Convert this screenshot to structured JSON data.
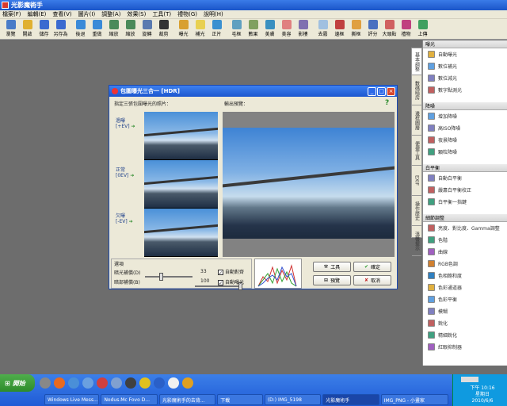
{
  "app": {
    "title": "光影魔術手"
  },
  "menu": [
    "檔案(F)",
    "編輯(E)",
    "查看(V)",
    "圖片(I)",
    "調整(A)",
    "效果(S)",
    "工具(T)",
    "禮物(G)",
    "說明(H)"
  ],
  "toolbar": [
    {
      "label": "瀏覽",
      "color": "#4a7cc8"
    },
    {
      "label": "開啟",
      "color": "#e0b030"
    },
    {
      "label": "儲存",
      "color": "#3a6ad0"
    },
    {
      "label": "另存為",
      "color": "#3a6ad0"
    },
    {
      "label": "後退",
      "color": "#3a8ad8"
    },
    {
      "label": "重做",
      "color": "#3a8ad8"
    },
    {
      "label": "縮放",
      "color": "#4a8a5a"
    },
    {
      "label": "縮放",
      "color": "#4a8a5a"
    },
    {
      "label": "旋轉",
      "color": "#5a7ab0"
    },
    {
      "label": "裁剪",
      "color": "#333"
    },
    {
      "label": "曝光",
      "color": "#d8a030"
    },
    {
      "label": "補光",
      "color": "#e8d050"
    },
    {
      "label": "正片",
      "color": "#3a90d0"
    },
    {
      "label": "毛框",
      "color": "#60a0c0"
    },
    {
      "label": "數果",
      "color": "#80a060"
    },
    {
      "label": "美膚",
      "color": "#3a90c0"
    },
    {
      "label": "美容",
      "color": "#e08080"
    },
    {
      "label": "影樓",
      "color": "#8070b0"
    },
    {
      "label": "去霧",
      "color": "#a0c0e0"
    },
    {
      "label": "邊框",
      "color": "#c04040"
    },
    {
      "label": "撕框",
      "color": "#e0a040"
    },
    {
      "label": "評分",
      "color": "#4a70c0"
    },
    {
      "label": "大頭貼",
      "color": "#d06060"
    },
    {
      "label": "禮物",
      "color": "#c04080"
    },
    {
      "label": "上傳",
      "color": "#40a060"
    }
  ],
  "right_tabs": [
    "基本調整",
    "數碼暗房",
    "邊框圖層",
    "便捷工具",
    "EXIF",
    "操作歷史",
    "溫馨提示"
  ],
  "right_panel": {
    "sections": [
      {
        "title": "曝光",
        "items": [
          "自動曝光",
          "數位補光",
          "數位減光",
          "數字點測光"
        ]
      },
      {
        "title": "降噪",
        "items": [
          "增加降噪",
          "高ISO降噪",
          "夜景降噪",
          "顆粒降噪"
        ]
      },
      {
        "title": "白平衡",
        "items": [
          "自動白平衡",
          "嚴肅白平衡校正",
          "白平衡一指鍵"
        ]
      },
      {
        "title": "細節調整",
        "items": [
          "亮度、對比度、Gamma調整",
          "色階",
          "曲線",
          "RGB色調",
          "色相飽和度",
          "色彩通道器",
          "色彩平衡",
          "模糊",
          "銳化",
          "精細銳化",
          "紅眼抑制器"
        ]
      }
    ]
  },
  "dialog": {
    "title": "包圍曝光三合一 [HDR]",
    "select_label": "指定三張包圍曝光的照片：",
    "output_label": "輸出預覽：",
    "help": "?",
    "exposures": [
      {
        "name": "過曝",
        "ev": "[+EV]"
      },
      {
        "name": "正常",
        "ev": "[0EV]"
      },
      {
        "name": "欠曝",
        "ev": "[-EV]"
      }
    ],
    "options_title": "選項",
    "dark_label": "暗光補償(D)",
    "dark_value": "33",
    "bright_label": "暗部補償(B)",
    "bright_value": "100",
    "auto_align": "自動對齊",
    "auto_exposure": "自動曝光",
    "tools_btn": "工具",
    "preview_btn": "預覽",
    "ok_btn": "確定",
    "cancel_btn": "取消"
  },
  "taskbar": {
    "start": "開始",
    "tasks": [
      "Windows Live Mess...",
      "Nodus.Mc Fovo D...",
      "光影魔術手的去背...",
      "下載",
      "(D:) IMG_5198",
      "光影魔術手",
      "IMG_PNG - 小畫家"
    ],
    "clock_time": "下午 10:16",
    "clock_day": "星期日",
    "clock_date": "2010/6/6"
  }
}
